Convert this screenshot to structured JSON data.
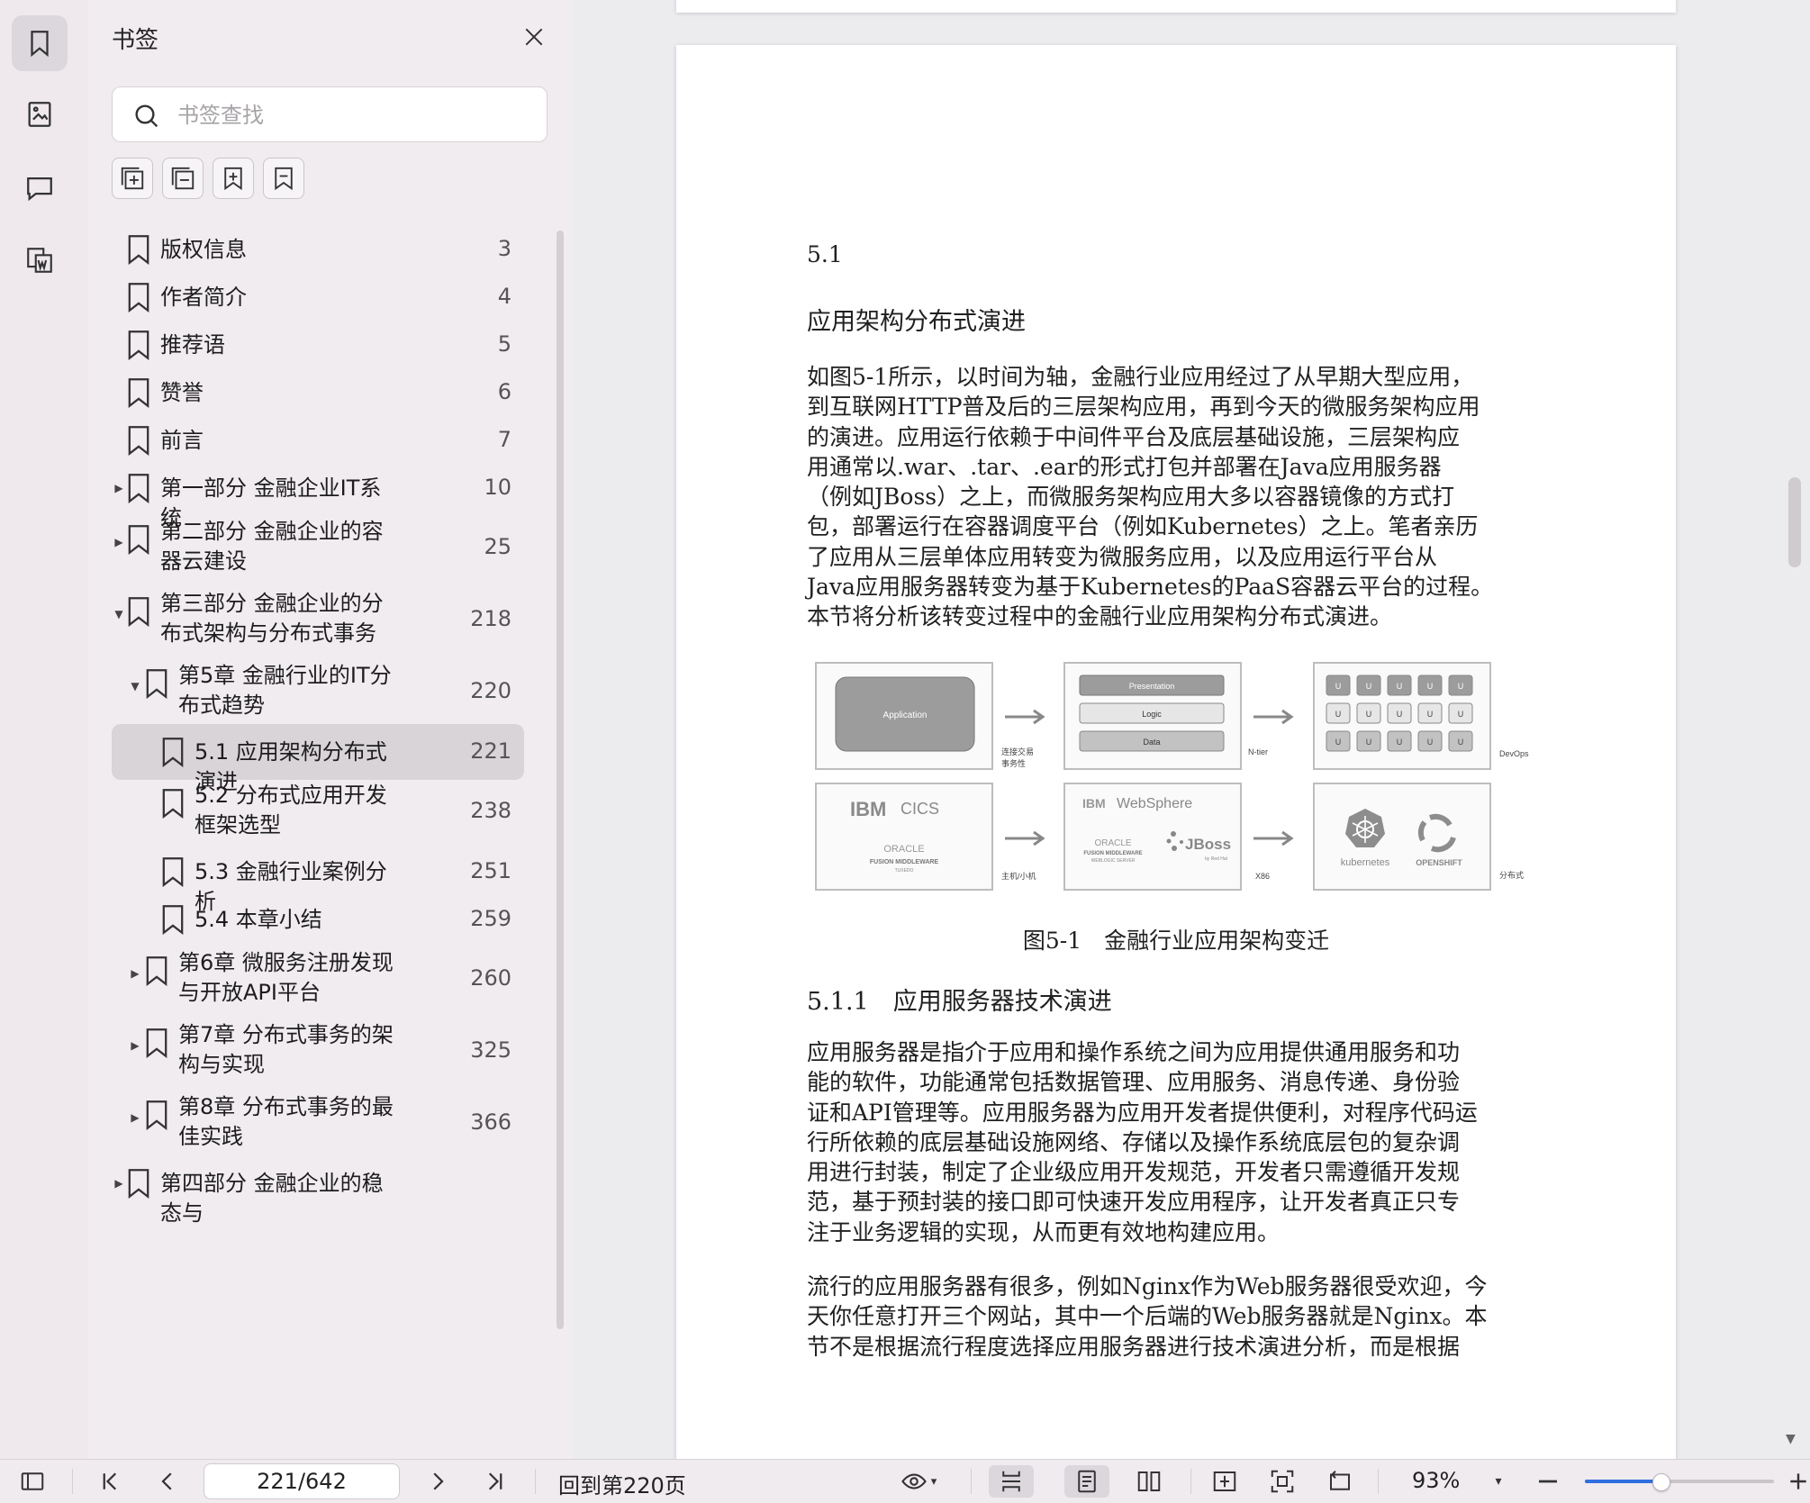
{
  "rail": {
    "items": [
      {
        "name": "bookmark-panel-icon",
        "active": true
      },
      {
        "name": "thumbnail-icon",
        "active": false
      },
      {
        "name": "comment-icon",
        "active": false
      },
      {
        "name": "word-convert-icon",
        "active": false
      }
    ]
  },
  "panel": {
    "title": "书签",
    "search_placeholder": "书签查找",
    "tools": [
      "add-bookmark-icon",
      "remove-bookmark-icon",
      "insert-bookmark-icon",
      "bookmark-flag-icon"
    ],
    "items": [
      {
        "label": "版权信息",
        "page": "3",
        "level": 0,
        "expand": ""
      },
      {
        "label": "作者简介",
        "page": "4",
        "level": 0,
        "expand": ""
      },
      {
        "label": "推荐语",
        "page": "5",
        "level": 0,
        "expand": ""
      },
      {
        "label": "赞誉",
        "page": "6",
        "level": 0,
        "expand": ""
      },
      {
        "label": "前言",
        "page": "7",
        "level": 0,
        "expand": ""
      },
      {
        "label": "第一部分 金融企业IT系统",
        "page": "10",
        "level": 0,
        "expand": "collapsed"
      },
      {
        "label": "第二部分 金融企业的容器云建设",
        "page": "25",
        "level": 0,
        "expand": "collapsed"
      },
      {
        "label": "第三部分 金融企业的分布式架构与分布式事务",
        "page": "218",
        "level": 0,
        "expand": "expanded"
      },
      {
        "label": "第5章 金融行业的IT分布式趋势",
        "page": "220",
        "level": 1,
        "expand": "expanded"
      },
      {
        "label": "5.1 应用架构分布式演进",
        "page": "221",
        "level": 2,
        "expand": "",
        "selected": true
      },
      {
        "label": "5.2 分布式应用开发框架选型",
        "page": "238",
        "level": 2,
        "expand": ""
      },
      {
        "label": "5.3 金融行业案例分析",
        "page": "251",
        "level": 2,
        "expand": ""
      },
      {
        "label": "5.4 本章小结",
        "page": "259",
        "level": 2,
        "expand": ""
      },
      {
        "label": "第6章 微服务注册发现与开放API平台",
        "page": "260",
        "level": 1,
        "expand": "collapsed"
      },
      {
        "label": "第7章 分布式事务的架构与实现",
        "page": "325",
        "level": 1,
        "expand": "collapsed"
      },
      {
        "label": "第8章 分布式事务的最佳实践",
        "page": "366",
        "level": 1,
        "expand": "collapsed"
      },
      {
        "label": "第四部分 金融企业的稳态与",
        "page": "",
        "level": 0,
        "expand": "collapsed"
      }
    ]
  },
  "document": {
    "section_number": "5.1",
    "section_title": "应用架构分布式演进",
    "para1_lines": [
      "如图5-1所示，以时间为轴，金融行业应用经过了从早期大型应用，",
      "到互联网HTTP普及后的三层架构应用，再到今天的微服务架构应用",
      "的演进。应用运行依赖于中间件平台及底层基础设施，三层架构应",
      "用通常以.war、.tar、.ear的形式打包并部署在Java应用服务器",
      "（例如JBoss）之上，而微服务架构应用大多以容器镜像的方式打",
      "包，部署运行在容器调度平台（例如Kubernetes）之上。笔者亲历",
      "了应用从三层单体应用转变为微服务应用，以及应用运行平台从",
      "Java应用服务器转变为基于Kubernetes的PaaS容器云平台的过程。",
      "本节将分析该转变过程中的金融行业应用架构分布式演进。"
    ],
    "figure": {
      "application": "Application",
      "tier1": "Presentation",
      "tier2": "Logic",
      "tier3": "Data",
      "micro_cell": "U",
      "label1": "连接交易",
      "label1b": "事务性",
      "label2": "N-tier",
      "label3": "DevOps",
      "label4": "主机/小机",
      "label5": "X86",
      "label6": "分布式",
      "ibm": "IBM",
      "cics": "CICS",
      "oracle": "ORACLE",
      "fusion": "FUSION MIDDLEWARE",
      "tuxedo": "TUXEDO",
      "websphere": "WebSphere",
      "weblogic": "WEBLOGIC SERVER",
      "jboss": "JBoss",
      "byredhat": "by Red Hat",
      "kubernetes": "kubernetes",
      "openshift": "OPENSHIFT"
    },
    "figure_caption": "图5-1　金融行业应用架构变迁",
    "subsection_title": "5.1.1　应用服务器技术演进",
    "para2_lines": [
      "应用服务器是指介于应用和操作系统之间为应用提供通用服务和功",
      "能的软件，功能通常包括数据管理、应用服务、消息传递、身份验",
      "证和API管理等。应用服务器为应用开发者提供便利，对程序代码运",
      "行所依赖的底层基础设施网络、存储以及操作系统底层包的复杂调",
      "用进行封装，制定了企业级应用开发规范，开发者只需遵循开发规",
      "范，基于预封装的接口即可快速开发应用程序，让开发者真正只专",
      "注于业务逻辑的实现，从而更有效地构建应用。"
    ],
    "para3_lines": [
      "流行的应用服务器有很多，例如Nginx作为Web服务器很受欢迎，今",
      "天你任意打开三个网站，其中一个后端的Web服务器就是Nginx。本",
      "节不是根据流行程度选择应用服务器进行技术演进分析，而是根据"
    ]
  },
  "toolbar": {
    "page_value": "221/642",
    "back_to": "回到第220页",
    "zoom": "93%",
    "zoom_level": 0.4
  }
}
